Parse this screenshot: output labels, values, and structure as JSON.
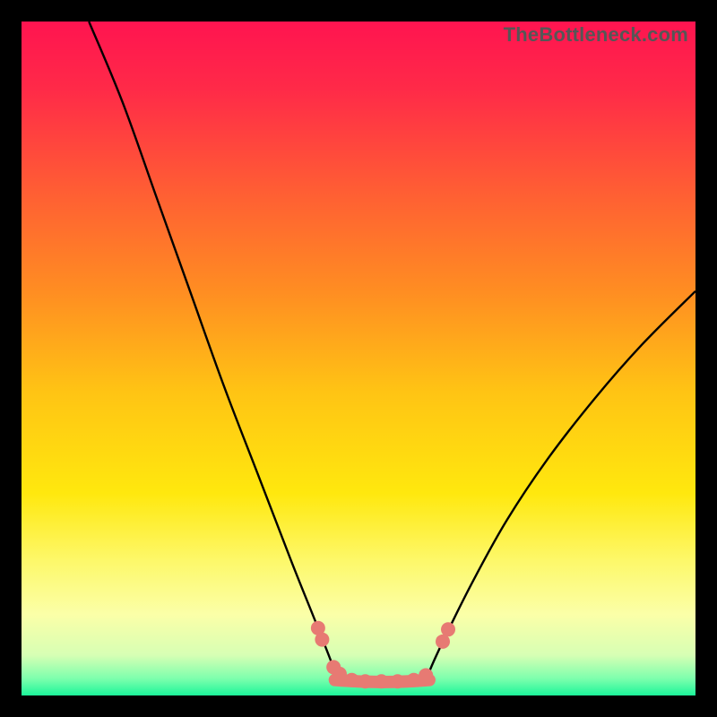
{
  "watermark": "TheBottleneck.com",
  "colors": {
    "frame": "#000000",
    "curve": "#000000",
    "marker": "#e77a73"
  },
  "chart_data": {
    "type": "line",
    "title": "",
    "xlabel": "",
    "ylabel": "",
    "xlim": [
      0,
      100
    ],
    "ylim": [
      0,
      100
    ],
    "gradient": [
      {
        "stop": 0.0,
        "color": "#ff1450"
      },
      {
        "stop": 0.1,
        "color": "#ff2a48"
      },
      {
        "stop": 0.25,
        "color": "#ff5d34"
      },
      {
        "stop": 0.4,
        "color": "#ff8d22"
      },
      {
        "stop": 0.55,
        "color": "#ffc414"
      },
      {
        "stop": 0.7,
        "color": "#ffe80e"
      },
      {
        "stop": 0.8,
        "color": "#fdf86a"
      },
      {
        "stop": 0.88,
        "color": "#fbffa8"
      },
      {
        "stop": 0.94,
        "color": "#d7ffb4"
      },
      {
        "stop": 0.975,
        "color": "#7dffad"
      },
      {
        "stop": 1.0,
        "color": "#1cf59a"
      }
    ],
    "series": [
      {
        "name": "left-branch",
        "x": [
          10,
          15,
          20,
          25,
          30,
          35,
          40,
          44,
          46.5
        ],
        "y": [
          100,
          88,
          74,
          60,
          46,
          33,
          20,
          10,
          3.5
        ]
      },
      {
        "name": "right-branch",
        "x": [
          60.5,
          63,
          67,
          72,
          78,
          85,
          92,
          100
        ],
        "y": [
          3.5,
          9,
          17,
          26,
          35,
          44,
          52,
          60
        ]
      }
    ],
    "basin": {
      "x_start": 46.5,
      "x_end": 60.5,
      "y": 2.3
    },
    "markers": [
      {
        "x": 44.0,
        "y": 10.0
      },
      {
        "x": 44.6,
        "y": 8.3
      },
      {
        "x": 46.3,
        "y": 4.2
      },
      {
        "x": 47.2,
        "y": 3.2
      },
      {
        "x": 49.0,
        "y": 2.3
      },
      {
        "x": 51.0,
        "y": 2.1
      },
      {
        "x": 53.4,
        "y": 2.1
      },
      {
        "x": 55.8,
        "y": 2.1
      },
      {
        "x": 58.2,
        "y": 2.3
      },
      {
        "x": 60.0,
        "y": 3.0
      },
      {
        "x": 62.5,
        "y": 8.0
      },
      {
        "x": 63.3,
        "y": 9.8
      }
    ]
  }
}
